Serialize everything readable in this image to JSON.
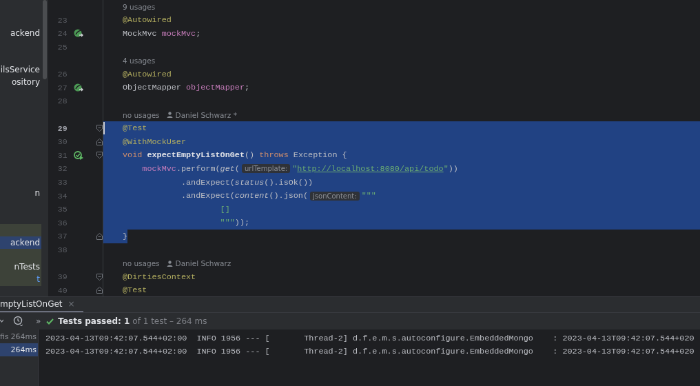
{
  "project_tree": {
    "items": [
      {
        "label": "ackend",
        "selected": false
      },
      {
        "label": "ilsService",
        "selected": false
      },
      {
        "label": "ository",
        "selected": false
      },
      {
        "label": "n",
        "selected": false
      }
    ],
    "highlighted_items": [
      {
        "label": "ackend",
        "selected": true,
        "kind": "module"
      },
      {
        "label": "nTests",
        "selected": false,
        "kind": "module"
      },
      {
        "label": "t",
        "selected": false,
        "kind": "test"
      }
    ]
  },
  "editor": {
    "rows": [
      {
        "kind": "hint",
        "text": "9 usages"
      },
      {
        "kind": "code",
        "number": "23",
        "current": false,
        "selected": false,
        "injected": false,
        "runnable": false,
        "fold_open": false,
        "fold_close": false,
        "tokens": [
          {
            "kind": "annotation",
            "text": "@Autowired"
          }
        ]
      },
      {
        "kind": "code",
        "number": "24",
        "current": false,
        "selected": false,
        "injected": true,
        "runnable": false,
        "fold_open": false,
        "fold_close": false,
        "tokens": [
          {
            "kind": "plain",
            "text": "MockMvc "
          },
          {
            "kind": "field",
            "text": "mockMvc"
          },
          {
            "kind": "plain",
            "text": ";"
          }
        ]
      },
      {
        "kind": "code",
        "number": "25",
        "current": false,
        "selected": false,
        "injected": false,
        "runnable": false,
        "fold_open": false,
        "fold_close": false
      },
      {
        "kind": "hint",
        "text": "4 usages"
      },
      {
        "kind": "code",
        "number": "26",
        "current": false,
        "selected": false,
        "injected": false,
        "runnable": false,
        "fold_open": false,
        "fold_close": false,
        "tokens": [
          {
            "kind": "annotation",
            "text": "@Autowired"
          }
        ]
      },
      {
        "kind": "code",
        "number": "27",
        "current": false,
        "selected": false,
        "injected": true,
        "runnable": false,
        "fold_open": false,
        "fold_close": false,
        "tokens": [
          {
            "kind": "plain",
            "text": "ObjectMapper "
          },
          {
            "kind": "field",
            "text": "objectMapper"
          },
          {
            "kind": "plain",
            "text": ";"
          }
        ]
      },
      {
        "kind": "code",
        "number": "28",
        "current": false,
        "selected": false,
        "injected": false,
        "runnable": false,
        "fold_open": false,
        "fold_close": false
      },
      {
        "kind": "hint",
        "text": "no usages",
        "author": "Daniel Schwarz *"
      },
      {
        "kind": "code",
        "number": "29",
        "current": true,
        "selected": true,
        "injected": false,
        "runnable": false,
        "fold_open": true,
        "fold_close": false,
        "tokens": [
          {
            "kind": "annotation",
            "text": "@Test"
          }
        ]
      },
      {
        "kind": "code",
        "number": "30",
        "current": false,
        "selected": true,
        "injected": false,
        "runnable": false,
        "fold_open": false,
        "fold_close": true,
        "tokens": [
          {
            "kind": "annotation",
            "text": "@WithMockUser"
          }
        ]
      },
      {
        "kind": "code",
        "number": "31",
        "current": false,
        "selected": true,
        "injected": false,
        "runnable": true,
        "fold_open": true,
        "fold_close": false,
        "tokens": [
          {
            "kind": "keyword",
            "text": "void "
          },
          {
            "kind": "method",
            "text": "expectEmptyListOnGet"
          },
          {
            "kind": "plain",
            "text": "() "
          },
          {
            "kind": "keyword",
            "text": "throws"
          },
          {
            "kind": "plain",
            "text": " Exception {"
          }
        ]
      },
      {
        "kind": "code",
        "number": "32",
        "current": false,
        "selected": true,
        "injected": false,
        "runnable": false,
        "fold_open": false,
        "fold_close": false,
        "tokens": [
          {
            "kind": "field",
            "text": "    mockMvc"
          },
          {
            "kind": "plain",
            "text": ".perform("
          },
          {
            "kind": "italic",
            "text": "get"
          },
          {
            "kind": "plain",
            "text": "("
          },
          {
            "kind": "inlay",
            "text": "urlTemplate:"
          },
          {
            "kind": "string",
            "text": "\""
          },
          {
            "kind": "url",
            "text": "http://localhost:8080/api/todo"
          },
          {
            "kind": "string",
            "text": "\""
          },
          {
            "kind": "plain",
            "text": "))"
          }
        ]
      },
      {
        "kind": "code",
        "number": "33",
        "current": false,
        "selected": true,
        "injected": false,
        "runnable": false,
        "fold_open": false,
        "fold_close": false,
        "tokens": [
          {
            "kind": "plain",
            "text": "            .andExpect("
          },
          {
            "kind": "italic",
            "text": "status"
          },
          {
            "kind": "plain",
            "text": "().isOk())"
          }
        ]
      },
      {
        "kind": "code",
        "number": "34",
        "current": false,
        "selected": true,
        "injected": false,
        "runnable": false,
        "fold_open": false,
        "fold_close": false,
        "tokens": [
          {
            "kind": "plain",
            "text": "            .andExpect("
          },
          {
            "kind": "italic",
            "text": "content"
          },
          {
            "kind": "plain",
            "text": "().json("
          },
          {
            "kind": "inlay",
            "text": "jsonContent:"
          },
          {
            "kind": "string",
            "text": "\"\"\""
          }
        ]
      },
      {
        "kind": "code",
        "number": "35",
        "current": false,
        "selected": true,
        "injected": false,
        "runnable": false,
        "fold_open": false,
        "fold_close": false,
        "tokens": [
          {
            "kind": "string",
            "text": "                    []"
          }
        ]
      },
      {
        "kind": "code",
        "number": "36",
        "current": false,
        "selected": true,
        "injected": false,
        "runnable": false,
        "fold_open": false,
        "fold_close": false,
        "tokens": [
          {
            "kind": "string",
            "text": "                    \"\"\""
          },
          {
            "kind": "plain",
            "text": "));"
          }
        ]
      },
      {
        "kind": "code",
        "number": "37",
        "current": false,
        "selected": true,
        "injected": false,
        "runnable": false,
        "fold_open": false,
        "fold_close": true,
        "tokens": [
          {
            "kind": "plain",
            "text": "}"
          }
        ]
      },
      {
        "kind": "code",
        "number": "38",
        "current": false,
        "selected": false,
        "injected": false,
        "runnable": false,
        "fold_open": false,
        "fold_close": false
      },
      {
        "kind": "hint",
        "text": "no usages",
        "author": "Daniel Schwarz"
      },
      {
        "kind": "code",
        "number": "39",
        "current": false,
        "selected": false,
        "injected": false,
        "runnable": false,
        "fold_open": true,
        "fold_close": false,
        "tokens": [
          {
            "kind": "annotation",
            "text": "@DirtiesContext"
          }
        ]
      },
      {
        "kind": "code",
        "number": "40",
        "current": false,
        "selected": false,
        "injected": false,
        "runnable": false,
        "fold_open": false,
        "fold_close": true,
        "tokens": [
          {
            "kind": "annotation",
            "text": "@Test"
          }
        ]
      }
    ]
  },
  "run_panel": {
    "tab": {
      "label": "mptyListOnGet",
      "close": "×",
      "selected": true
    },
    "toolbar": {
      "more": "»",
      "status": "Tests passed: 1",
      "detail": "of 1 test – 264 ms"
    },
    "test_tree": [
      {
        "label": "fis",
        "duration": "264ms",
        "selected": false
      },
      {
        "duration": "264ms",
        "selected": true
      }
    ],
    "console_lines": [
      "2023-04-13T09:42:07.544+02:00  INFO 1956 --- [       Thread-2] d.f.e.m.s.autoconfigure.EmbeddedMongo    : 2023-04-13T09:42:07.544+020",
      "2023-04-13T09:42:07.544+02:00  INFO 1956 --- [       Thread-2] d.f.e.m.s.autoconfigure.EmbeddedMongo    : 2023-04-13T09:42:07.544+020"
    ]
  }
}
